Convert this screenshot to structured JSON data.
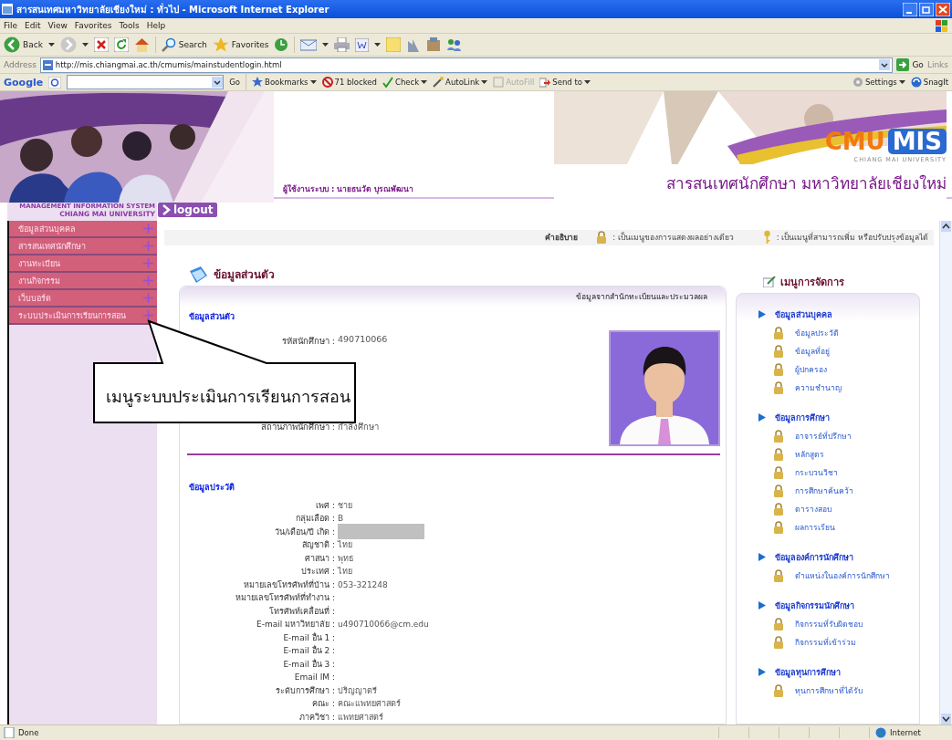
{
  "window": {
    "title": "สารสนเทศมหาวิทยาลัยเชียงใหม่ : ทั่วไป - Microsoft Internet Explorer"
  },
  "menu_bar": [
    "File",
    "Edit",
    "View",
    "Favorites",
    "Tools",
    "Help"
  ],
  "toolbar": {
    "back": "Back",
    "search": "Search",
    "favorites": "Favorites"
  },
  "address_bar": {
    "label": "Address",
    "url": "http://mis.chiangmai.ac.th/cmumis/mainstudentlogin.html",
    "go": "Go",
    "links": "Links"
  },
  "google_bar": {
    "brand": "Google",
    "go": "Go",
    "items": [
      {
        "label": "Bookmarks",
        "dropdown": true,
        "disabled": false
      },
      {
        "label": "71 blocked",
        "dropdown": false,
        "disabled": false
      },
      {
        "label": "Check",
        "dropdown": true,
        "disabled": false
      },
      {
        "label": "AutoLink",
        "dropdown": true,
        "disabled": false
      },
      {
        "label": "AutoFill",
        "dropdown": false,
        "disabled": true
      },
      {
        "label": "Send to",
        "dropdown": true,
        "disabled": false
      }
    ],
    "right_items": [
      {
        "label": "Settings",
        "dropdown": true,
        "disabled": false
      },
      {
        "label": "SnagIt",
        "dropdown": false,
        "disabled": false
      }
    ]
  },
  "header": {
    "user": "ผู้ใช้งานระบบ : นายธนวัต บุรณพัฒนา",
    "logo_left": "CMU",
    "logo_right": "MIS",
    "logo_sub": "CHIANG MAI UNIVERSITY",
    "site_title": "สารสนเทศนักศึกษา มหาวิทยาลัยเชียงใหม่",
    "mis_line1": "MANAGEMENT INFORMATION SYSTEM",
    "mis_line2": "CHIANG MAI UNIVERSITY",
    "logout": "logout"
  },
  "sidebar": {
    "items": [
      "ข้อมูลส่วนบุคคล",
      "สารสนเทศนักศึกษา",
      "งานทะเบียน",
      "งานกิจกรรม",
      "เว็บบอร์ด",
      "ระบบประเมินการเรียนการสอน"
    ]
  },
  "legend": {
    "title": "คำอธิบาย",
    "view_only": ": เป็นเมนูของการแสดงผลอย่างเดียว",
    "editable": ": เป็นเมนูที่สามารถเพิ่ม หรือปรับปรุงข้อมูลได้"
  },
  "profile": {
    "title": "ข้อมูลส่วนตัว",
    "source": "ข้อมูลจากสำนักทะเบียนและประมวลผล",
    "section": "ข้อมูลส่วนตัว",
    "fields": [
      {
        "label": "รหัสนักศึกษา :",
        "value": "490710066"
      },
      {
        "label": "สถานภาพนักศึกษา :",
        "value": "กำลังศึกษา"
      }
    ],
    "history_title": "ข้อมูลประวัติ",
    "history": [
      {
        "kind": "text",
        "label": "เพศ :",
        "value": "ชาย"
      },
      {
        "kind": "text",
        "label": "กลุ่มเลือด :",
        "value": "B"
      },
      {
        "kind": "redacted",
        "label": "วัน/เดือน/ปี เกิด :"
      },
      {
        "kind": "text",
        "label": "สัญชาติ :",
        "value": "ไทย"
      },
      {
        "kind": "text",
        "label": "ศาสนา :",
        "value": "พุทธ"
      },
      {
        "kind": "text",
        "label": "ประเทศ :",
        "value": "ไทย"
      },
      {
        "kind": "text",
        "label": "หมายเลขโทรศัพท์ที่บ้าน :",
        "value": "053-321248"
      },
      {
        "kind": "text",
        "label": "หมายเลขโทรศัพท์ที่ทำงาน :"
      },
      {
        "kind": "text",
        "label": "โทรศัพท์เคลื่อนที่ :"
      },
      {
        "kind": "text",
        "label": "E-mail มหาวิทยาลัย :",
        "value": "u490710066@cm.edu"
      },
      {
        "kind": "text",
        "label": "E-mail อื่น 1 :"
      },
      {
        "kind": "text",
        "label": "E-mail อื่น 2 :"
      },
      {
        "kind": "text",
        "label": "E-mail อื่น 3 :"
      },
      {
        "kind": "text",
        "label": "Email IM :"
      },
      {
        "kind": "text",
        "label": "ระดับการศึกษา :",
        "value": "ปริญญาตรี"
      },
      {
        "kind": "text",
        "label": "คณะ :",
        "value": "คณะแพทยศาสตร์"
      },
      {
        "kind": "text",
        "label": "ภาควิชา :",
        "value": "แพทยศาสตร์"
      }
    ]
  },
  "manage_menu": {
    "title": "เมนูการจัดการ",
    "groups": [
      {
        "title": "ข้อมูลส่วนบุคคล",
        "items": [
          "ข้อมูลประวัติ",
          "ข้อมูลที่อยู่",
          "ผู้ปกครอง",
          "ความชำนาญ"
        ]
      },
      {
        "title": "ข้อมูลการศึกษา",
        "items": [
          "อาจารย์ที่ปรึกษา",
          "หลักสูตร",
          "กระบวนวิชา",
          "การศึกษาค้นคว้า",
          "ตารางสอบ",
          "ผลการเรียน"
        ]
      },
      {
        "title": "ข้อมูลองค์การนักศึกษา",
        "items": [
          "ตำแหน่งในองค์การนักศึกษา"
        ]
      },
      {
        "title": "ข้อมูลกิจกรรมนักศึกษา",
        "items": [
          "กิจกรรมที่รับผิดชอบ",
          "กิจกรรมที่เข้าร่วม"
        ]
      },
      {
        "title": "ข้อมูลทุนการศึกษา",
        "items": [
          "ทุนการศึกษาที่ได้รับ"
        ]
      }
    ]
  },
  "callout": {
    "text": "เมนูระบบประเมินการเรียนการสอน"
  },
  "status_bar": {
    "text": "Done",
    "zone": "Internet"
  }
}
